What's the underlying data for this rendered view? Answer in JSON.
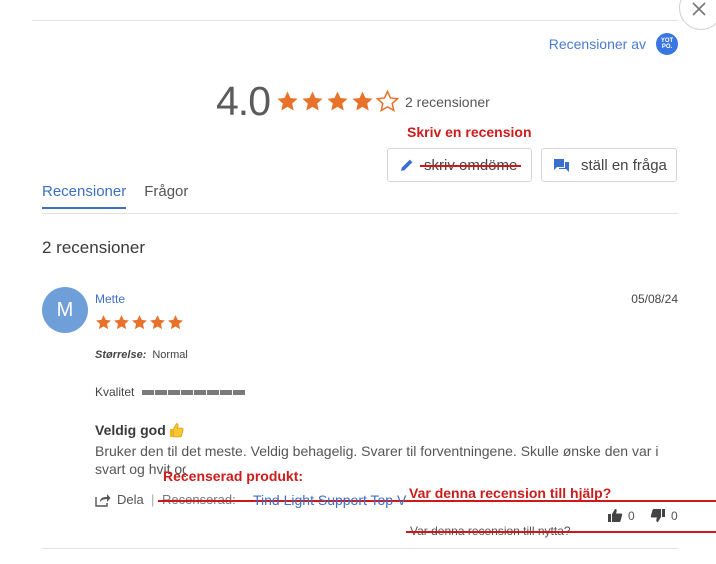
{
  "header": {
    "powered_by": "Recensioner av",
    "logo_text": "YOT PO."
  },
  "summary": {
    "average": "4.0",
    "stars": 4,
    "star_total": 5,
    "review_count": "2 recensioner"
  },
  "annotations": {
    "write_review": "Skriv en recension",
    "reviewed_product": "Recenserad produkt:",
    "was_helpful": "Var denna recension till hjälp?"
  },
  "actions": {
    "write_review_label": "skriv omdöme",
    "ask_question_label": "ställ en fråga"
  },
  "tabs": [
    {
      "label": "Recensioner",
      "active": true
    },
    {
      "label": "Frågor",
      "active": false
    }
  ],
  "reviews_header": "2 recensioner",
  "review": {
    "avatar_letter": "M",
    "author": "Mette",
    "date": "05/08/24",
    "stars": 5,
    "size_label": "Størrelse:",
    "size_value": "Normal",
    "quality_label": "Kvalitet",
    "title": "Veldig god",
    "body": "Bruker den til det meste. Veldig behagelig. Svarer til forventningene. Skulle ønske den var i svart og hvit også",
    "share_label": "Dela",
    "separator": "|",
    "reviewed_label": "Recenserad:",
    "product_name": "Tind Light Support Top V",
    "helpful_question": "Var denna recension till nytta?",
    "thumbs_up_count": "0",
    "thumbs_down_count": "0"
  },
  "colors": {
    "star": "#e8722a",
    "accent": "#3d6fc4",
    "annotation": "#cc1c1c"
  }
}
